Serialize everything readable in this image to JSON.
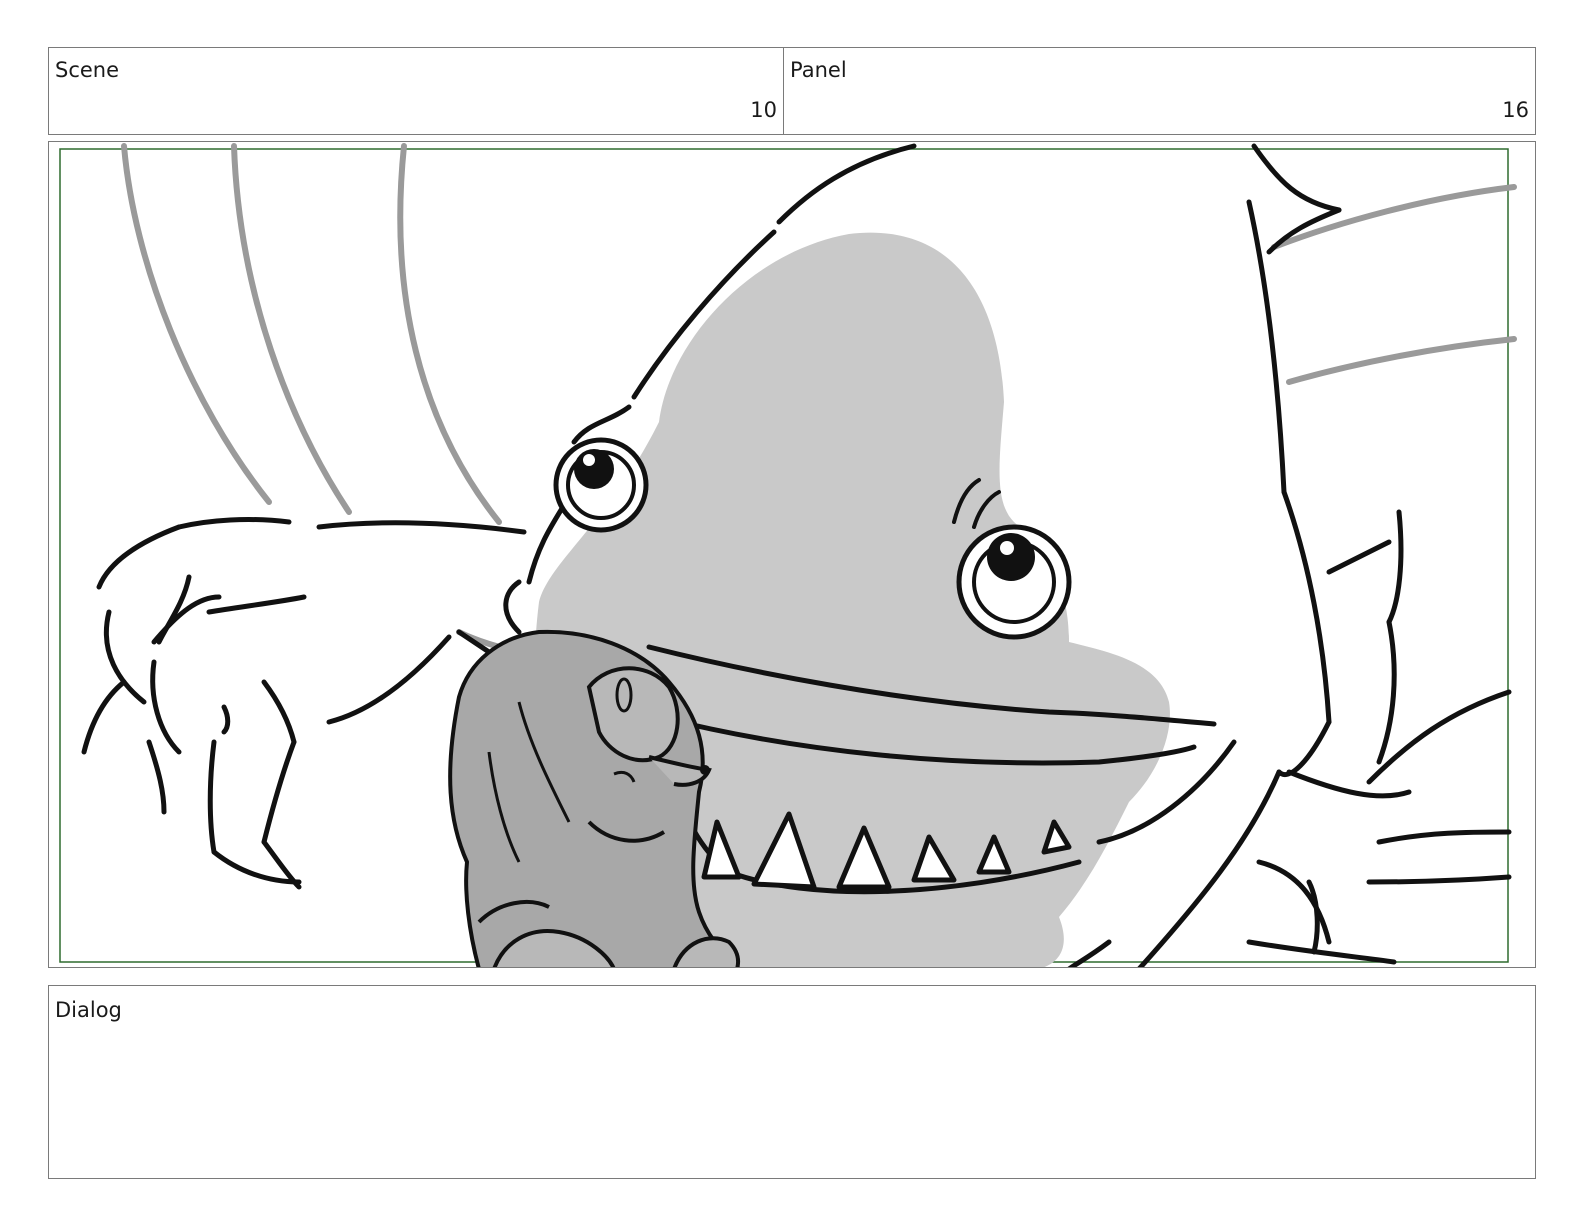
{
  "header": {
    "scene_label": "Scene",
    "scene_value": "10",
    "panel_label": "Panel",
    "panel_value": "16"
  },
  "dialog": {
    "label": "Dialog",
    "text": ""
  },
  "colors": {
    "border": "#7a7a7a",
    "safe_frame": "#2f6b2f",
    "ink": "#111111",
    "grey_fill": "#c9c9c9",
    "grey_stroke": "#9a9a9a",
    "character_fill": "#a8a8a8"
  }
}
